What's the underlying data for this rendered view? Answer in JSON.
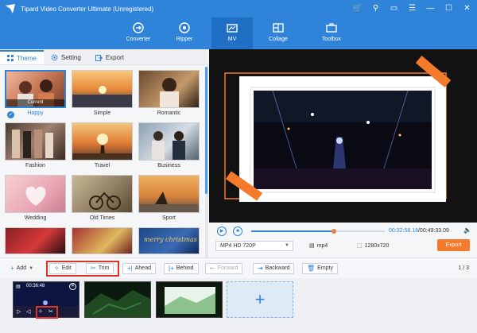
{
  "app": {
    "title": "Tipard Video Converter Ultimate (Unregistered)"
  },
  "nav": {
    "items": [
      {
        "label": "Converter"
      },
      {
        "label": "Ripper"
      },
      {
        "label": "MV"
      },
      {
        "label": "Collage"
      },
      {
        "label": "Toolbox"
      }
    ],
    "active": "MV"
  },
  "left_tabs": [
    {
      "label": "Theme"
    },
    {
      "label": "Setting"
    },
    {
      "label": "Export"
    }
  ],
  "themes": [
    {
      "label": "Happy",
      "selected": true,
      "badge": "Current"
    },
    {
      "label": "Simple"
    },
    {
      "label": "Romantic"
    },
    {
      "label": "Fashion"
    },
    {
      "label": "Travel"
    },
    {
      "label": "Business"
    },
    {
      "label": "Wedding"
    },
    {
      "label": "Old Times"
    },
    {
      "label": "Sport"
    },
    {
      "label": ""
    },
    {
      "label": ""
    },
    {
      "label": "merry christmas"
    }
  ],
  "player": {
    "current_time": "00:32:58.18",
    "total_time": "/00:49:33.09",
    "progress": 0.62,
    "format": "MP4 HD 720P",
    "container": "mp4",
    "resolution": "1280x720",
    "export_label": "Export"
  },
  "toolbar": {
    "add": "Add",
    "edit": "Edit",
    "trim": "Trim",
    "ahead": "Ahead",
    "behind": "Behind",
    "forward": "Forward",
    "backward": "Backward",
    "empty": "Empty",
    "page": "1 / 3"
  },
  "clips": [
    {
      "time": "00:36:48"
    }
  ],
  "colors": {
    "accent": "#2f84da",
    "orange": "#f47a2c",
    "highlight": "#d9352a"
  }
}
